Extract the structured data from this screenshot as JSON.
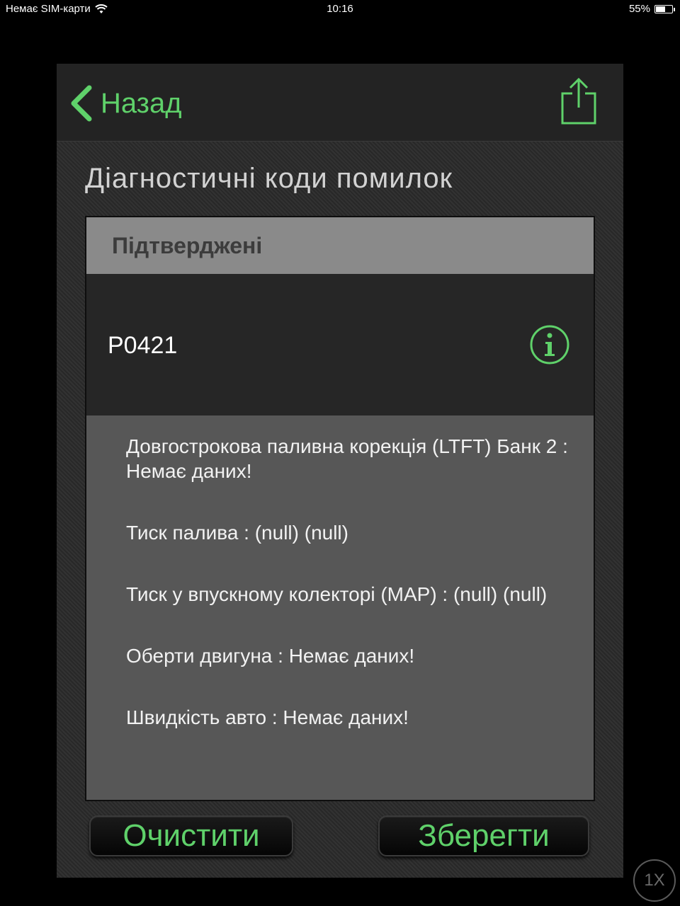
{
  "status_bar": {
    "carrier": "Немає SIM-карти",
    "time": "10:16",
    "battery": "55%",
    "battery_level": 0.55
  },
  "nav": {
    "back_label": "Назад",
    "accent": "#5fd16a"
  },
  "page_title": "Діагностичні коди помилок",
  "section": {
    "header": "Підтверджені",
    "code": "P0421",
    "details": [
      "Довгострокова паливна корекція (LTFT) Банк 2 : Немає даних!",
      "Тиск палива : (null) (null)",
      "Тиск у впускному колекторі (MAP) : (null) (null)",
      "Оберти двигуна : Немає даних!",
      "Швидкість авто : Немає даних!"
    ]
  },
  "buttons": {
    "clear": "Очистити",
    "save": "Зберегти"
  },
  "zoom_badge": "1X"
}
